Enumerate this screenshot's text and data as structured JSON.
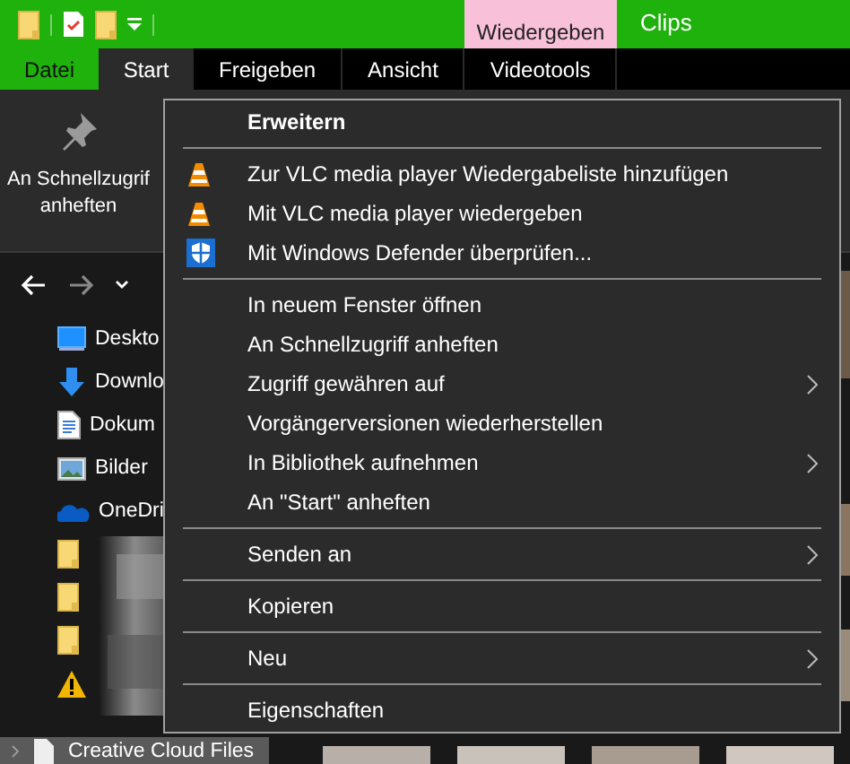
{
  "title_bar": {
    "group_label": "Wiedergeben",
    "title": "Clips"
  },
  "ribbon_tabs": [
    {
      "label": "Datei",
      "kind": "file",
      "selected": false
    },
    {
      "label": "Start",
      "kind": "tab",
      "selected": true
    },
    {
      "label": "Freigeben",
      "kind": "tab",
      "selected": false
    },
    {
      "label": "Ansicht",
      "kind": "tab",
      "selected": false
    },
    {
      "label": "Videotools",
      "kind": "tab",
      "selected": false
    }
  ],
  "ribbon": {
    "pin_button": {
      "label": "An Schnellzugrif\nanheften"
    }
  },
  "nav_pane": {
    "items": [
      {
        "kind": "desktop",
        "label": "Deskto"
      },
      {
        "kind": "download",
        "label": "Downlo"
      },
      {
        "kind": "document",
        "label": "Dokum"
      },
      {
        "kind": "pictures",
        "label": "Bilder"
      },
      {
        "kind": "cloud",
        "label": "OneDri"
      },
      {
        "kind": "folder"
      },
      {
        "kind": "folder"
      },
      {
        "kind": "folder"
      },
      {
        "kind": "warning"
      }
    ],
    "bottom_item": {
      "label": "Creative Cloud Files",
      "selected": true
    }
  },
  "context_menu": {
    "items": [
      {
        "kind": "item",
        "label": "Erweitern",
        "default": true,
        "submenu": false
      },
      {
        "kind": "separator"
      },
      {
        "kind": "vlc",
        "label": "Zur VLC media player Wiedergabeliste hinzufügen",
        "default": false,
        "submenu": false
      },
      {
        "kind": "vlc",
        "label": "Mit VLC media player wiedergeben",
        "default": false,
        "submenu": false
      },
      {
        "kind": "defender",
        "label": "Mit Windows Defender überprüfen...",
        "default": false,
        "submenu": false
      },
      {
        "kind": "separator"
      },
      {
        "kind": "item",
        "label": "In neuem Fenster öffnen",
        "default": false,
        "submenu": false
      },
      {
        "kind": "item",
        "label": "An Schnellzugriff anheften",
        "default": false,
        "submenu": false
      },
      {
        "kind": "item",
        "label": "Zugriff gewähren auf",
        "default": false,
        "submenu": true
      },
      {
        "kind": "item",
        "label": "Vorgängerversionen wiederherstellen",
        "default": false,
        "submenu": false
      },
      {
        "kind": "item",
        "label": "In Bibliothek aufnehmen",
        "default": false,
        "submenu": true
      },
      {
        "kind": "item",
        "label": "An \"Start\" anheften",
        "default": false,
        "submenu": false
      },
      {
        "kind": "separator"
      },
      {
        "kind": "item",
        "label": "Senden an",
        "default": false,
        "submenu": true
      },
      {
        "kind": "separator"
      },
      {
        "kind": "item",
        "label": "Kopieren",
        "default": false,
        "submenu": false
      },
      {
        "kind": "separator"
      },
      {
        "kind": "item",
        "label": "Neu",
        "default": false,
        "submenu": true
      },
      {
        "kind": "separator"
      },
      {
        "kind": "item",
        "label": "Eigenschaften",
        "default": false,
        "submenu": false
      }
    ]
  }
}
